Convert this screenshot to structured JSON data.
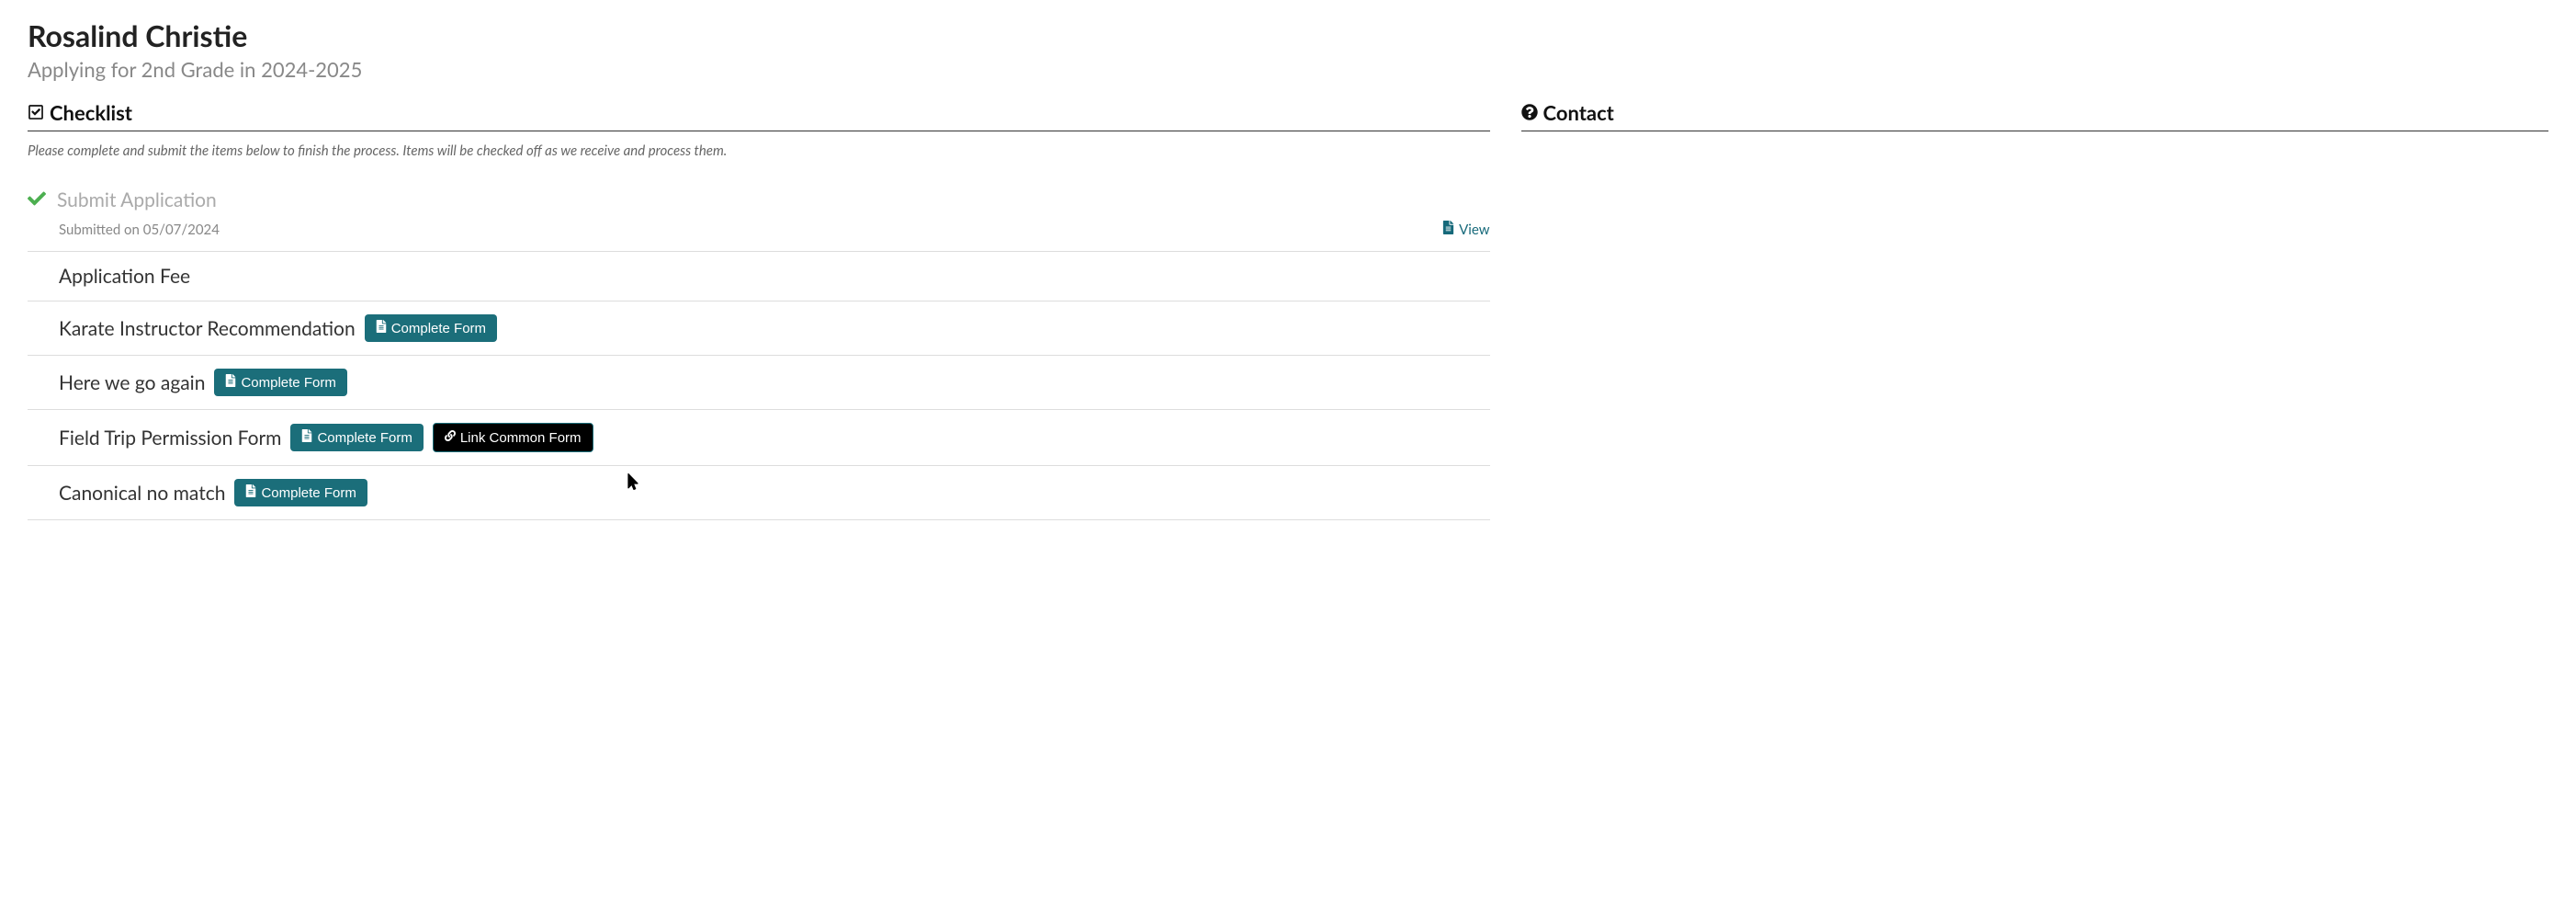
{
  "header": {
    "title": "Rosalind Christie",
    "subtitle": "Applying for 2nd Grade in 2024-2025"
  },
  "checklist_section": {
    "heading": "Checklist",
    "instruction": "Please complete and submit the items below to finish the process. Items will be checked off as we receive and process them."
  },
  "contact_section": {
    "heading": "Contact"
  },
  "checklist": [
    {
      "title": "Submit Application",
      "submitted_text": "Submitted on 05/07/2024",
      "view_label": "View",
      "completed": true
    },
    {
      "title": "Application Fee"
    },
    {
      "title": "Karate Instructor Recommendation",
      "complete_label": "Complete Form"
    },
    {
      "title": "Here we go again",
      "complete_label": "Complete Form"
    },
    {
      "title": "Field Trip Permission Form",
      "complete_label": "Complete Form",
      "link_common_label": "Link Common Form"
    },
    {
      "title": "Canonical no match",
      "complete_label": "Complete Form"
    }
  ]
}
